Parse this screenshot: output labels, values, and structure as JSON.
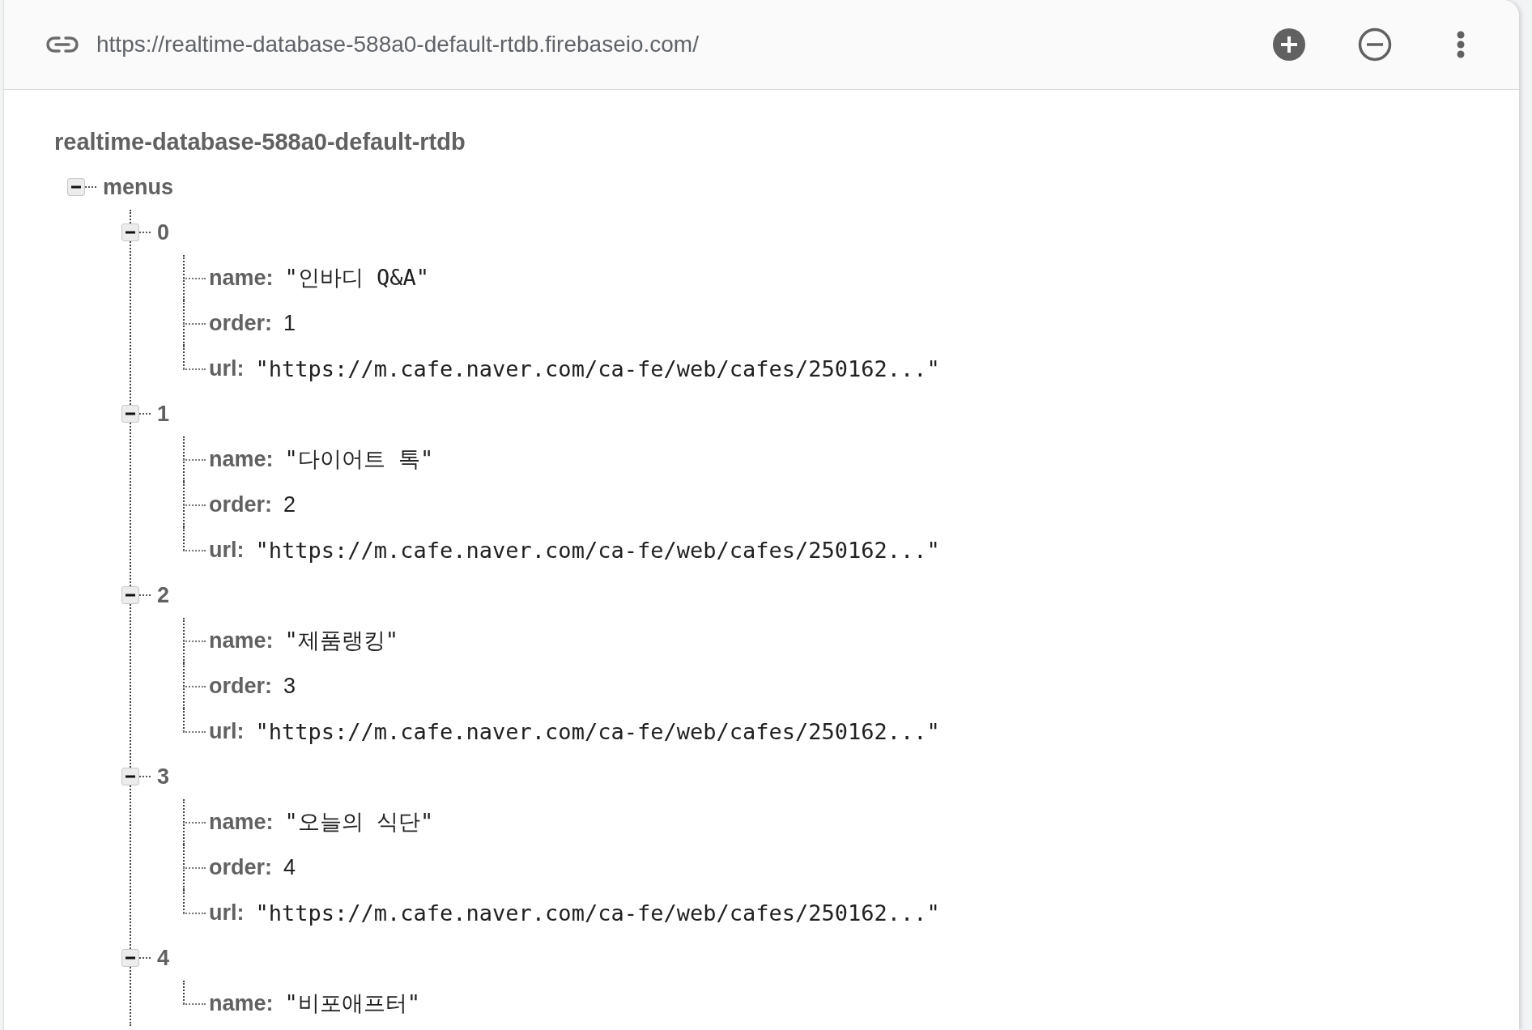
{
  "toolbar": {
    "url": "https://realtime-database-588a0-default-rtdb.firebaseio.com/"
  },
  "tree": {
    "root": "realtime-database-588a0-default-rtdb",
    "node": {
      "key": "menus",
      "expanded": true,
      "children": [
        {
          "key": "0",
          "expanded": true,
          "fields": [
            {
              "key": "name:",
              "kind": "string",
              "value": "\"인바디 Q&A\""
            },
            {
              "key": "order:",
              "kind": "number",
              "value": "1"
            },
            {
              "key": "url:",
              "kind": "string",
              "value": "\"https://m.cafe.naver.com/ca-fe/web/cafes/250162...\""
            }
          ]
        },
        {
          "key": "1",
          "expanded": true,
          "fields": [
            {
              "key": "name:",
              "kind": "string",
              "value": "\"다이어트 톡\""
            },
            {
              "key": "order:",
              "kind": "number",
              "value": "2"
            },
            {
              "key": "url:",
              "kind": "string",
              "value": "\"https://m.cafe.naver.com/ca-fe/web/cafes/250162...\""
            }
          ]
        },
        {
          "key": "2",
          "expanded": true,
          "fields": [
            {
              "key": "name:",
              "kind": "string",
              "value": "\"제품랭킹\""
            },
            {
              "key": "order:",
              "kind": "number",
              "value": "3"
            },
            {
              "key": "url:",
              "kind": "string",
              "value": "\"https://m.cafe.naver.com/ca-fe/web/cafes/250162...\""
            }
          ]
        },
        {
          "key": "3",
          "expanded": true,
          "fields": [
            {
              "key": "name:",
              "kind": "string",
              "value": "\"오늘의 식단\""
            },
            {
              "key": "order:",
              "kind": "number",
              "value": "4"
            },
            {
              "key": "url:",
              "kind": "string",
              "value": "\"https://m.cafe.naver.com/ca-fe/web/cafes/250162...\""
            }
          ]
        },
        {
          "key": "4",
          "expanded": true,
          "fields": [
            {
              "key": "name:",
              "kind": "string",
              "value": "\"비포애프터\""
            }
          ]
        }
      ]
    }
  }
}
